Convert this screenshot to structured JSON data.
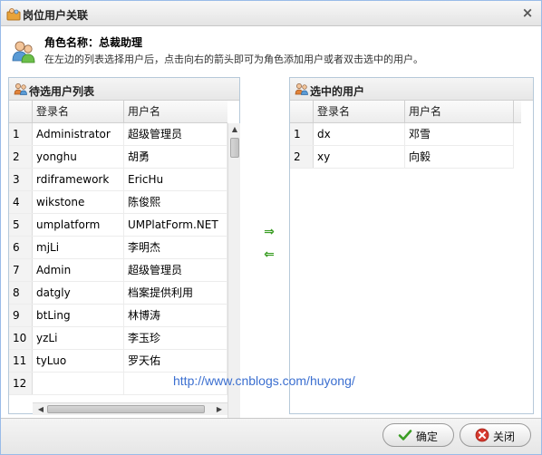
{
  "window": {
    "title": "岗位用户关联",
    "close_glyph": "×"
  },
  "info": {
    "role_title": "角色名称：总裁助理",
    "description": "在左边的列表选择用户后，点击向右的箭头即可为角色添加用户或者双击选中的用户。"
  },
  "left_panel": {
    "title": "待选用户列表",
    "columns": [
      "",
      "登录名",
      "用户名"
    ],
    "rows": [
      {
        "num": "1",
        "login": "Administrator",
        "name": "超级管理员"
      },
      {
        "num": "2",
        "login": "yonghu",
        "name": "胡勇"
      },
      {
        "num": "3",
        "login": "rdiframework",
        "name": "EricHu"
      },
      {
        "num": "4",
        "login": "wikstone",
        "name": "陈俊熙"
      },
      {
        "num": "5",
        "login": "umplatform",
        "name": "UMPlatForm.NET"
      },
      {
        "num": "6",
        "login": "mjLi",
        "name": "李明杰"
      },
      {
        "num": "7",
        "login": "Admin",
        "name": "超级管理员"
      },
      {
        "num": "8",
        "login": "datgly",
        "name": "档案提供利用"
      },
      {
        "num": "9",
        "login": "btLing",
        "name": "林博涛"
      },
      {
        "num": "10",
        "login": "yzLi",
        "name": "李玉珍"
      },
      {
        "num": "11",
        "login": "tyLuo",
        "name": "罗天佑"
      },
      {
        "num": "12",
        "login": "",
        "name": ""
      }
    ]
  },
  "right_panel": {
    "title": "选中的用户",
    "columns": [
      "",
      "登录名",
      "用户名"
    ],
    "rows": [
      {
        "num": "1",
        "login": "dx",
        "name": "邓雪"
      },
      {
        "num": "2",
        "login": "xy",
        "name": "向毅"
      }
    ]
  },
  "arrows": {
    "add_glyph": "⇒",
    "remove_glyph": "⇐"
  },
  "watermark": "http://www.cnblogs.com/huyong/",
  "footer": {
    "ok_label": "确定",
    "close_label": "关闭"
  },
  "colors": {
    "accent_green": "#3a9d23",
    "link_blue": "#3b6fd0",
    "close_red": "#d63a2f"
  }
}
